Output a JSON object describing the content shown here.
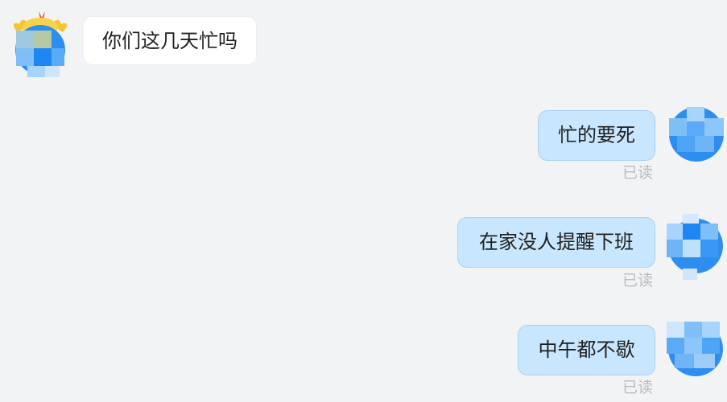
{
  "conversation": {
    "messages": [
      {
        "direction": "incoming",
        "text": "你们这几天忙吗"
      },
      {
        "direction": "outgoing",
        "text": "忙的要死",
        "status": "已读"
      },
      {
        "direction": "outgoing",
        "text": "在家没人提醒下班",
        "status": "已读"
      },
      {
        "direction": "outgoing",
        "text": "中午都不歇",
        "status": "已读"
      }
    ]
  },
  "colors": {
    "background": "#f2f3f5",
    "incoming_bubble": "#ffffff",
    "outgoing_bubble": "#c8e6fd",
    "read_status": "#b9bcc2",
    "avatar_blue": "#2e8ef0"
  },
  "icons": {
    "contact_avatar": "chick-avatar-icon",
    "self_avatar": "user-avatar-icon"
  }
}
